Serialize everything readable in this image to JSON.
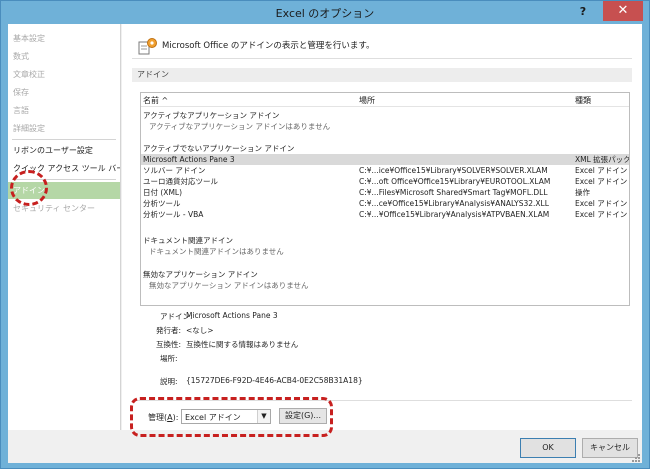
{
  "window": {
    "title": "Excel のオプション",
    "help_label": "?",
    "close_label": "✕"
  },
  "sidebar": {
    "items": [
      {
        "label": "基本設定",
        "state": "disabled"
      },
      {
        "label": "数式",
        "state": "disabled"
      },
      {
        "label": "文章校正",
        "state": "disabled"
      },
      {
        "label": "保存",
        "state": "disabled"
      },
      {
        "label": "言語",
        "state": "disabled"
      },
      {
        "label": "詳細設定",
        "state": "disabled"
      },
      {
        "label": "リボンのユーザー設定",
        "state": "normal"
      },
      {
        "label": "クイック アクセス ツール バー",
        "state": "normal"
      },
      {
        "label": "アドイン",
        "state": "selected"
      },
      {
        "label": "セキュリティ センター",
        "state": "disabled"
      }
    ]
  },
  "header": {
    "text": "Microsoft Office のアドインの表示と管理を行います。",
    "icon": "gear-addin-icon"
  },
  "section": {
    "title": "アドイン"
  },
  "grid": {
    "columns": [
      "名前 ^",
      "場所",
      "種類"
    ],
    "active_title": "アクティブなアプリケーション アドイン",
    "active_empty": "アクティブなアプリケーション アドインはありません",
    "inactive_title": "アクティブでないアプリケーション アドイン",
    "inactive_rows": [
      {
        "name": "Microsoft Actions Pane 3",
        "location": "",
        "type": "XML 拡張パック",
        "selected": true
      },
      {
        "name": "ソルバー アドイン",
        "location": "C:¥...ice¥Office15¥Library¥SOLVER¥SOLVER.XLAM",
        "type": "Excel アドイン",
        "selected": false
      },
      {
        "name": "ユーロ通貨対応ツール",
        "location": "C:¥...oft Office¥Office15¥Library¥EUROTOOL.XLAM",
        "type": "Excel アドイン",
        "selected": false
      },
      {
        "name": "日付 (XML)",
        "location": "C:¥...Files¥Microsoft Shared¥Smart Tag¥MOFL.DLL",
        "type": "操作",
        "selected": false
      },
      {
        "name": "分析ツール",
        "location": "C:¥...ce¥Office15¥Library¥Analysis¥ANALYS32.XLL",
        "type": "Excel アドイン",
        "selected": false
      },
      {
        "name": "分析ツール - VBA",
        "location": "C:¥...¥Office15¥Library¥Analysis¥ATPVBAEN.XLAM",
        "type": "Excel アドイン",
        "selected": false
      }
    ],
    "document_title": "ドキュメント関連アドイン",
    "document_empty": "ドキュメント関連アドインはありません",
    "disabled_title": "無効なアプリケーション アドイン",
    "disabled_empty": "無効なアプリケーション アドインはありません"
  },
  "details": {
    "addin_label": "アドイン:",
    "addin_value": "Microsoft Actions Pane 3",
    "publisher_label": "発行者:",
    "publisher_value": "<なし>",
    "compat_label": "互換性:",
    "compat_value": "互換性に関する情報はありません",
    "location_label": "場所:",
    "location_value": "",
    "desc_label": "説明:",
    "desc_value": "{15727DE6-F92D-4E46-ACB4-0E2C58B31A18}"
  },
  "manage": {
    "label_pre": "管理(",
    "label_key": "A",
    "label_post": "):",
    "selected": "Excel アドイン",
    "go_label": "設定(G)..."
  },
  "buttons": {
    "ok": "OK",
    "cancel": "キャンセル"
  },
  "colors": {
    "title_bar": "#6fb1d8",
    "close_button": "#c75050",
    "selected_nav": "#b5d7a6",
    "annotation": "#c7201f"
  }
}
